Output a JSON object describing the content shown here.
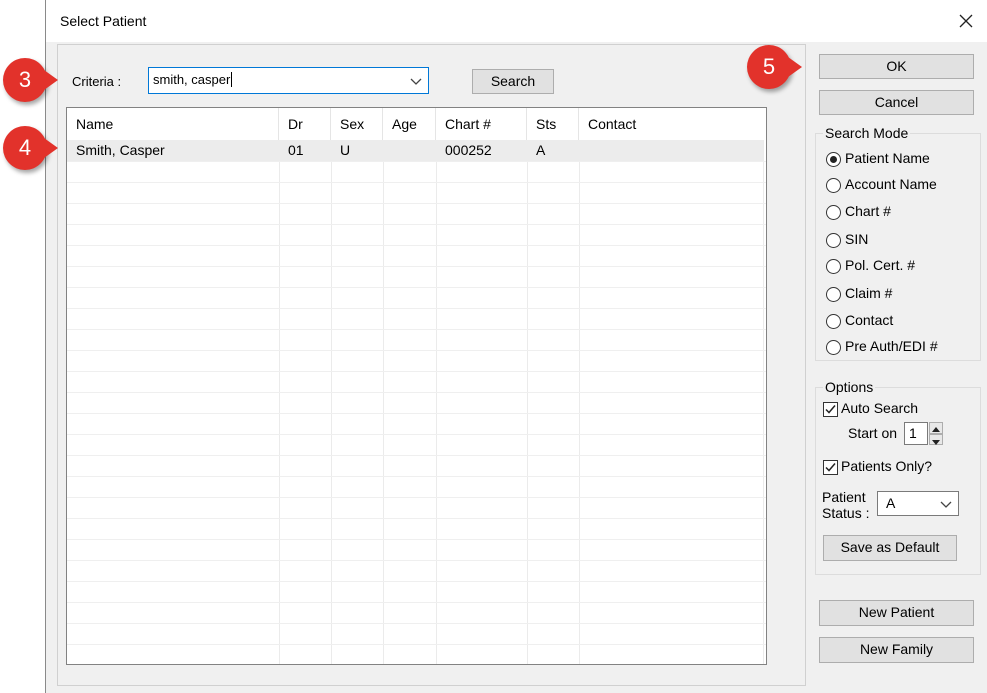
{
  "window": {
    "title": "Select Patient"
  },
  "criteria": {
    "label": "Criteria :",
    "value": "smith, casper",
    "search_button": "Search"
  },
  "grid": {
    "columns": [
      "Name",
      "Dr",
      "Sex",
      "Age",
      "Chart #",
      "Sts",
      "Contact"
    ],
    "rows": [
      {
        "name": "Smith, Casper",
        "dr": "01",
        "sex": "U",
        "age": "",
        "chart": "000252",
        "sts": "A",
        "contact": ""
      }
    ]
  },
  "actions": {
    "ok": "OK",
    "cancel": "Cancel",
    "new_patient": "New Patient",
    "new_family": "New Family"
  },
  "search_mode": {
    "title": "Search Mode",
    "selected": "Patient Name",
    "options": [
      "Patient Name",
      "Account Name",
      "Chart #",
      "SIN",
      "Pol. Cert. #",
      "Claim #",
      "Contact",
      "Pre Auth/EDI #"
    ]
  },
  "options": {
    "title": "Options",
    "auto_search_label": "Auto Search",
    "auto_search_checked": true,
    "start_on_label": "Start on",
    "start_on_value": "1",
    "patients_only_label": "Patients Only?",
    "patients_only_checked": true,
    "patient_status_label_1": "Patient",
    "patient_status_label_2": "Status :",
    "patient_status_value": "A",
    "save_default": "Save as Default"
  },
  "annotations": {
    "badge_3": "3",
    "badge_4": "4",
    "badge_5": "5"
  },
  "colors": {
    "accent": "#0078d7",
    "badge": "#e2322b",
    "row_selected": "#ececec"
  }
}
